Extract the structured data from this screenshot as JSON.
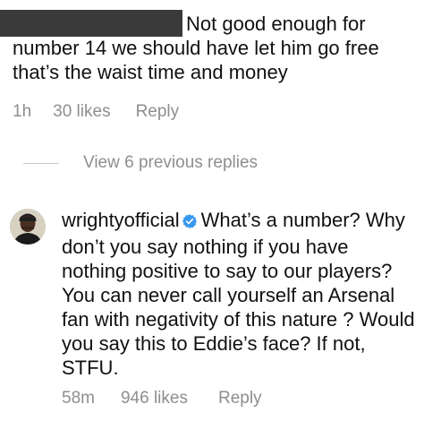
{
  "comment_parent": {
    "text": "Not good enough for number 14 we should have let him go free that’s the waist time and money",
    "time": "1h",
    "likes": "30 likes",
    "reply_label": "Reply"
  },
  "view_replies": {
    "label": "View 6 previous replies"
  },
  "comment_reply": {
    "username": "wrightyofficial",
    "text": "What’s a number? Why don’t you say nothing if you have nothing positive to say to our players? You can never call yourself an Arsenal fan with negativity of this nature ? Would you say this to Eddie’s face? If not, STFU.",
    "time": "58m",
    "likes": "946 likes",
    "reply_label": "Reply"
  },
  "colors": {
    "verified_badge": "#3897f0",
    "meta_text": "#8e8e8e"
  },
  "icons": {
    "verified": "verified-badge-icon",
    "avatar": "user-avatar"
  }
}
